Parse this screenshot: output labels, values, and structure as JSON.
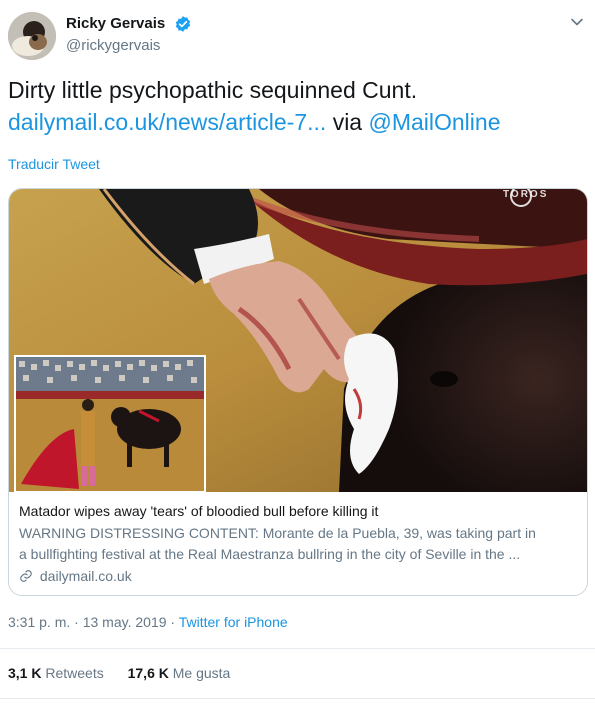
{
  "user": {
    "display_name": "Ricky Gervais",
    "handle": "@rickygervais",
    "verified": true
  },
  "tweet": {
    "text": "Dirty little psychopathic sequinned Cunt.",
    "link_text": "dailymail.co.uk/news/article-7...",
    "via_text": "via",
    "mention": "@MailOnline",
    "translate_label": "Traducir Tweet"
  },
  "card": {
    "watermark": "TOROS",
    "title": "Matador wipes away 'tears' of bloodied bull before killing it",
    "description_line1": "WARNING DISTRESSING CONTENT: Morante de la Puebla, 39, was taking part in",
    "description_line2": "a bullfighting festival at the Real Maestranza bullring in the city of Seville in the ...",
    "domain": "dailymail.co.uk"
  },
  "meta": {
    "time": "3:31 p. m.",
    "separator": "·",
    "date": "13 may. 2019",
    "source": "Twitter for iPhone"
  },
  "stats": {
    "retweets_count": "3,1 K",
    "retweets_label": "Retweets",
    "likes_count": "17,6 K",
    "likes_label": "Me gusta"
  },
  "colors": {
    "link": "#1b95e0",
    "secondary_text": "#657786",
    "primary_text": "#14171a",
    "border": "#e6ecf0"
  },
  "icons": [
    "verified-badge-icon",
    "chevron-down-icon",
    "link-icon"
  ]
}
